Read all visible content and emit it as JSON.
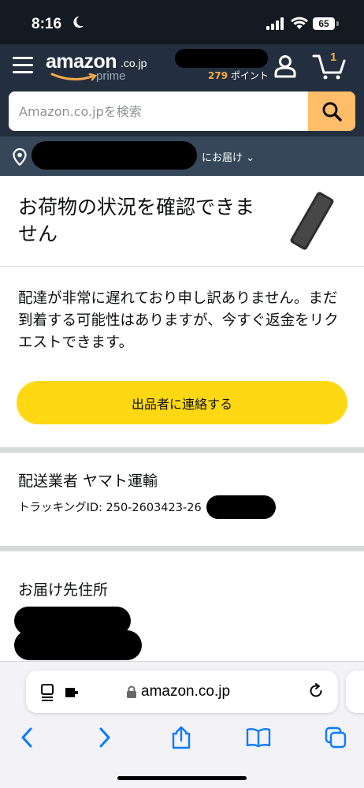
{
  "status_bar": {
    "time": "8:16",
    "battery": "65"
  },
  "header": {
    "logo": {
      "main": "amazon",
      "domain": ".co.jp",
      "sub": "prime"
    },
    "points": {
      "number": "279",
      "label": "ポイント"
    },
    "cart_count": "1",
    "search": {
      "placeholder": "Amazon.co.jpを検索"
    }
  },
  "delivery": {
    "label": "にお届け ⌄"
  },
  "page": {
    "title": "お荷物の状況を確認できません",
    "message": "配達が非常に遅れており申し訳ありません。まだ到着する可能性はありますが、今すぐ返金をリクエストできます。",
    "contact_button": "出品者に連絡する",
    "carrier": {
      "title": "配送業者 ヤマト運輸",
      "tracking": "トラッキングID: 250-2603423-26"
    },
    "address": {
      "title": "お届け先住所"
    }
  },
  "browser": {
    "url": "amazon.co.jp"
  },
  "colors": {
    "header_bg": "#232f3e",
    "delivery_bg": "#37475a",
    "button_yellow": "#ffd814",
    "search_button": "#febd69",
    "accent_orange": "#f7a948"
  }
}
